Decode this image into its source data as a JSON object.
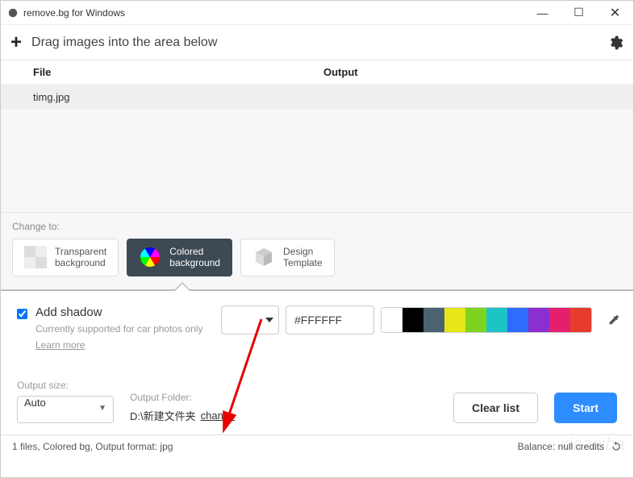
{
  "titlebar": {
    "title": "remove.bg for Windows"
  },
  "toolbar": {
    "hint": "Drag images into the area below"
  },
  "list": {
    "headers": {
      "file": "File",
      "output": "Output"
    },
    "rows": [
      {
        "file": "timg.jpg",
        "output": ""
      }
    ]
  },
  "change_to": {
    "label": "Change to:",
    "options": [
      {
        "id": "transparent",
        "line1": "Transparent",
        "line2": "background"
      },
      {
        "id": "colored",
        "line1": "Colored",
        "line2": "background",
        "selected": true
      },
      {
        "id": "design",
        "line1": "Design",
        "line2": "Template"
      }
    ]
  },
  "shadow": {
    "title": "Add shadow",
    "subtitle": "Currently supported for car photos only",
    "learn_more": "Learn more",
    "checked": true
  },
  "color": {
    "hex": "#FFFFFF",
    "swatches": [
      "#ffffff",
      "#000000",
      "#4a6272",
      "#e6e619",
      "#7ed321",
      "#1cc4c4",
      "#2d6cff",
      "#8b2fd0",
      "#e61e6e",
      "#e63c2f"
    ]
  },
  "output": {
    "size_label": "Output size:",
    "size_value": "Auto",
    "folder_label": "Output Folder:",
    "folder_path": "D:\\新建文件夹",
    "change": "change",
    "clear": "Clear list",
    "start": "Start"
  },
  "statusbar": {
    "left": "1 files, Colored bg, Output format: jpg",
    "right": "Balance: null credits"
  }
}
